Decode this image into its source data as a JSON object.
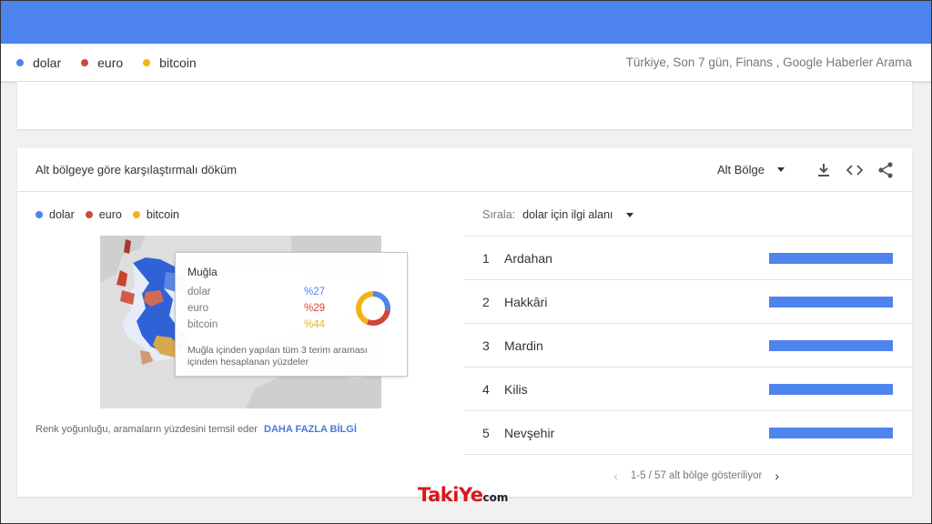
{
  "legend": {
    "terms": [
      {
        "label": "dolar",
        "color": "#4e84ee"
      },
      {
        "label": "euro",
        "color": "#d0473a"
      },
      {
        "label": "bitcoin",
        "color": "#f2b318"
      }
    ],
    "meta": "Türkiye, Son 7 gün, Finans , Google Haberler Arama"
  },
  "card": {
    "title": "Alt bölgeye göre karşılaştırmalı döküm",
    "region_select": "Alt Bölge",
    "icons": [
      "download-icon",
      "embed-code-icon",
      "share-icon"
    ]
  },
  "map_tooltip": {
    "region": "Muğla",
    "rows": [
      {
        "term": "dolar",
        "value": "%27",
        "pct": 27,
        "color": "#4e84ee"
      },
      {
        "term": "euro",
        "value": "%29",
        "pct": 29,
        "color": "#d0473a"
      },
      {
        "term": "bitcoin",
        "value": "%44",
        "pct": 44,
        "color": "#f2b318"
      }
    ],
    "note": "Muğla içinden yapılan tüm 3 terim araması içinden hesaplanan yüzdeler"
  },
  "footnote": {
    "text": "Renk yoğunluğu, aramaların yüzdesini temsil eder",
    "link": "DAHA FAZLA BİLGİ"
  },
  "sort": {
    "label": "Sırala:",
    "value": "dolar için ilgi alanı"
  },
  "ranking": [
    {
      "rank": "1",
      "name": "Ardahan",
      "value": 100
    },
    {
      "rank": "2",
      "name": "Hakkâri",
      "value": 100
    },
    {
      "rank": "3",
      "name": "Mardin",
      "value": 100
    },
    {
      "rank": "4",
      "name": "Kilis",
      "value": 100
    },
    {
      "rank": "5",
      "name": "Nevşehir",
      "value": 100
    }
  ],
  "pager": {
    "text": "1-5 / 57 alt bölge gösteriliyor",
    "prev": "‹",
    "next": "›"
  },
  "watermark": {
    "brand": "TakiYe",
    "suffix": "com"
  }
}
